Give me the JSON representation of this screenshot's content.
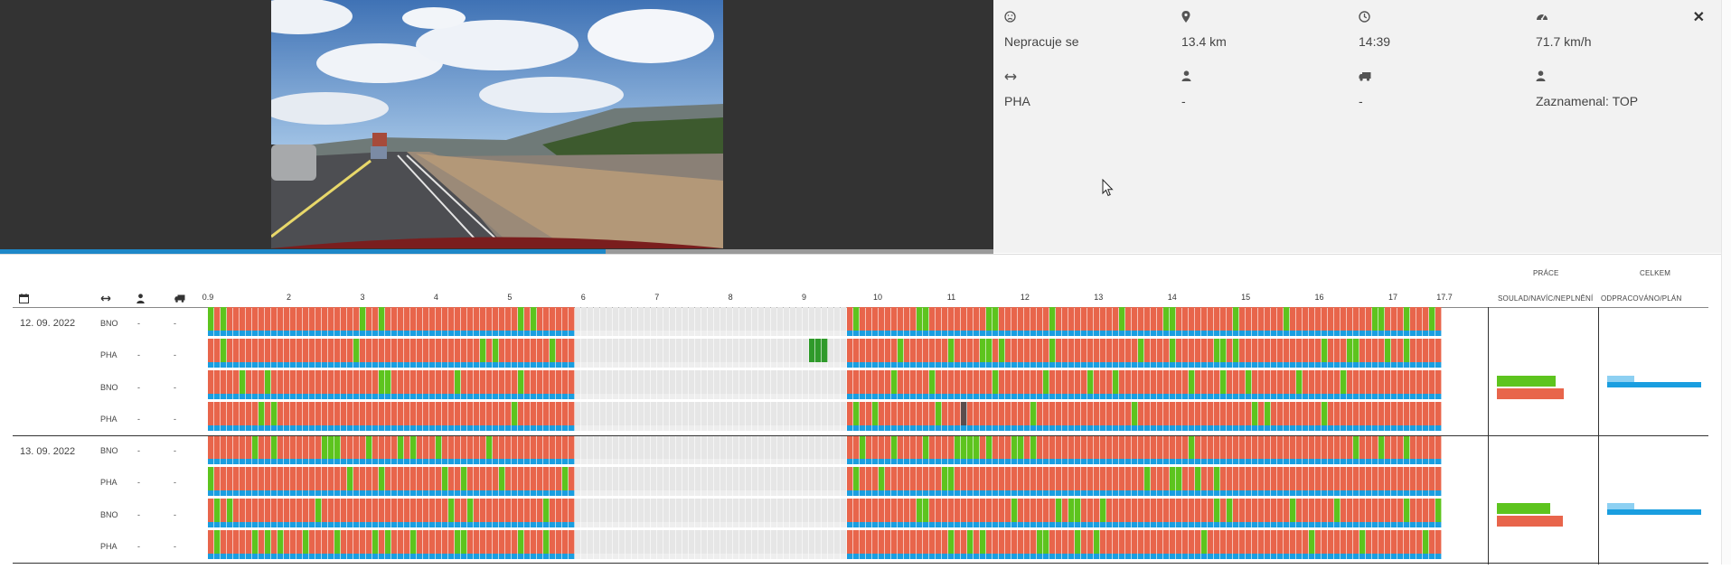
{
  "video": {
    "progress_fraction": 0.61
  },
  "info_panel": {
    "row1": [
      {
        "icon": "frown-icon",
        "value": "Nepracuje se"
      },
      {
        "icon": "map-marker-icon",
        "value": "13.4 km"
      },
      {
        "icon": "clock-icon",
        "value": "14:39"
      },
      {
        "icon": "speedometer-icon",
        "value": "71.7 km/h"
      }
    ],
    "row2": [
      {
        "icon": "route-arrows-icon",
        "value": "PHA"
      },
      {
        "icon": "user-icon",
        "value": "-"
      },
      {
        "icon": "truck-icon",
        "value": "-"
      },
      {
        "icon": "user-icon",
        "value": "Zaznamenal: TOP"
      }
    ],
    "close_label": "✕"
  },
  "table": {
    "headers": {
      "prace": "PRÁCE",
      "celkem": "CELKEM",
      "prace_sub": "SOULAD/NAVÍC/NEPLNĚNÍ",
      "celkem_sub": "ODPRACOVÁNO/PLÁN"
    },
    "header_icons": [
      "calendar-icon",
      "route-arrows-icon",
      "user-icon",
      "truck-icon"
    ],
    "ticks": [
      "0.9",
      "2",
      "3",
      "4",
      "5",
      "6",
      "7",
      "8",
      "9",
      "10",
      "11",
      "12",
      "13",
      "14",
      "15",
      "16",
      "17",
      "17.7"
    ],
    "days": [
      {
        "date": "12. 09. 2022",
        "rows": [
          {
            "route": "BNO",
            "driver": "-",
            "vehicle": "-"
          },
          {
            "route": "PHA",
            "driver": "-",
            "vehicle": "-"
          },
          {
            "route": "BNO",
            "driver": "-",
            "vehicle": "-"
          },
          {
            "route": "PHA",
            "driver": "-",
            "vehicle": "-"
          }
        ],
        "prace": {
          "soulad": 0.88,
          "neplneni": 1.0
        },
        "celkem": {
          "odpracovano": 0.29,
          "plan": 1.0
        }
      },
      {
        "date": "13. 09. 2022",
        "rows": [
          {
            "route": "BNO",
            "driver": "-",
            "vehicle": "-"
          },
          {
            "route": "PHA",
            "driver": "-",
            "vehicle": "-"
          },
          {
            "route": "BNO",
            "driver": "-",
            "vehicle": "-"
          },
          {
            "route": "PHA",
            "driver": "-",
            "vehicle": "-"
          }
        ],
        "prace": {
          "soulad": 0.8,
          "neplneni": 0.98
        },
        "celkem": {
          "odpracovano": 0.29,
          "plan": 1.0
        }
      }
    ],
    "colors": {
      "red": "#e8654b",
      "green": "#5dc41e",
      "dark_green": "#2f9a2a",
      "blue": "#1a9ee0",
      "light_blue": "#8dd0f2",
      "gray_gap": "#e6e6e6",
      "dark_cell": "#5a4d4d"
    }
  }
}
